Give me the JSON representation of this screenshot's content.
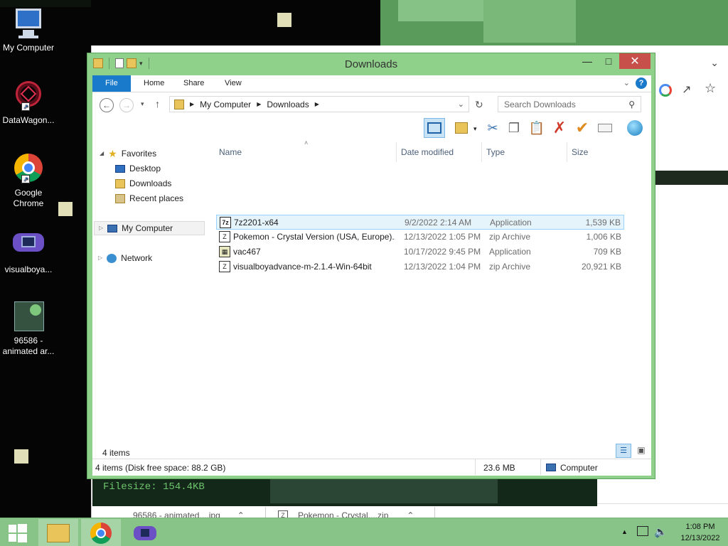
{
  "desktop": {
    "icons": [
      {
        "label": "My Computer",
        "icon": "computer-icon"
      },
      {
        "label": "DataWagon...",
        "icon": "datawagon-icon"
      },
      {
        "label": "Google Chrome",
        "icon": "chrome-icon"
      },
      {
        "label": "visualboya...",
        "icon": "gameboy-icon"
      },
      {
        "label": "96586 - animated ar...",
        "icon": "image-file-icon"
      }
    ],
    "console_text": "Filesize: 154.4KB"
  },
  "chrome": {
    "downloads": [
      {
        "name": "96586 - animated....jpg"
      },
      {
        "name": "Pokemon - Crystal....zip"
      }
    ]
  },
  "explorer": {
    "title": "Downloads",
    "tabs": [
      "File",
      "Home",
      "Share",
      "View"
    ],
    "breadcrumb": [
      "My Computer",
      "Downloads"
    ],
    "search_placeholder": "Search Downloads",
    "nav": {
      "favorites": "Favorites",
      "desktop": "Desktop",
      "downloads": "Downloads",
      "recent": "Recent places",
      "computer": "My Computer",
      "network": "Network"
    },
    "columns": [
      "Name",
      "Date modified",
      "Type",
      "Size"
    ],
    "files": [
      {
        "name": "7z2201-x64",
        "date": "9/2/2022 2:14 AM",
        "type": "Application",
        "size": "1,539 KB",
        "icon": "app-icon"
      },
      {
        "name": "Pokemon - Crystal Version (USA, Europe)...",
        "date": "12/13/2022 1:05 PM",
        "type": "zip Archive",
        "size": "1,006 KB",
        "icon": "zip-icon"
      },
      {
        "name": "vac467",
        "date": "10/17/2022 9:45 PM",
        "type": "Application",
        "size": "709 KB",
        "icon": "app-icon"
      },
      {
        "name": "visualboyadvance-m-2.1.4-Win-64bit",
        "date": "12/13/2022 1:04 PM",
        "type": "zip Archive",
        "size": "20,921 KB",
        "icon": "zip-icon"
      }
    ],
    "item_count": "4 items",
    "status": {
      "left": "4 items (Disk free space: 88.2 GB)",
      "middle": "23.6 MB",
      "right": "Computer"
    }
  },
  "taskbar": {
    "time": "1:08 PM",
    "date": "12/13/2022"
  },
  "colors": {
    "accent": "#1979ca",
    "window_frame": "#8fd08a",
    "taskbar": "#88c488",
    "close_button": "#c7504a"
  }
}
